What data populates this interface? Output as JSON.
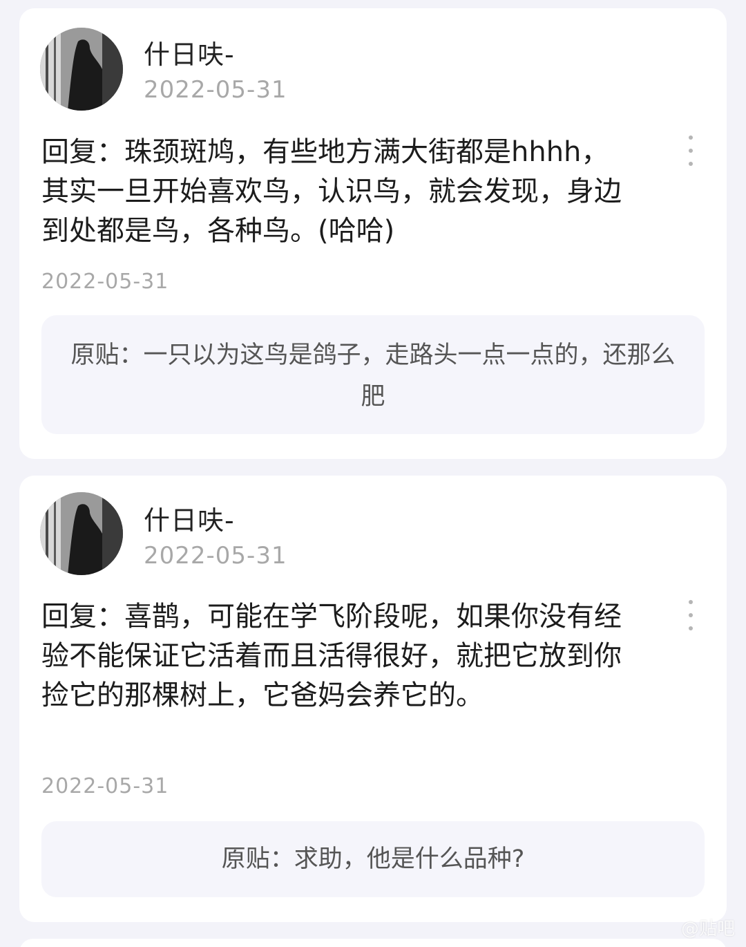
{
  "replies": [
    {
      "username": "什日呋-",
      "header_date": "2022-05-31",
      "content": "回复：珠颈斑鸠，有些地方满大街都是hhhh，其实一旦开始喜欢鸟，认识鸟，就会发现，身边到处都是鸟，各种鸟。(哈哈)",
      "post_date": "2022-05-31",
      "original_post": "原贴：一只以为这鸟是鸽子，走路头一点一点的，还那么肥"
    },
    {
      "username": "什日呋-",
      "header_date": "2022-05-31",
      "content": "回复：喜鹊，可能在学飞阶段呢，如果你没有经验不能保证它活着而且活得很好，就把它放到你捡它的那棵树上，它爸妈会养它的。",
      "post_date": "2022-05-31",
      "original_post": "原贴：求助，他是什么品种?"
    }
  ],
  "watermark": "@贴吧",
  "icons": {
    "more": "more-vertical-icon",
    "avatar": "user-avatar"
  }
}
